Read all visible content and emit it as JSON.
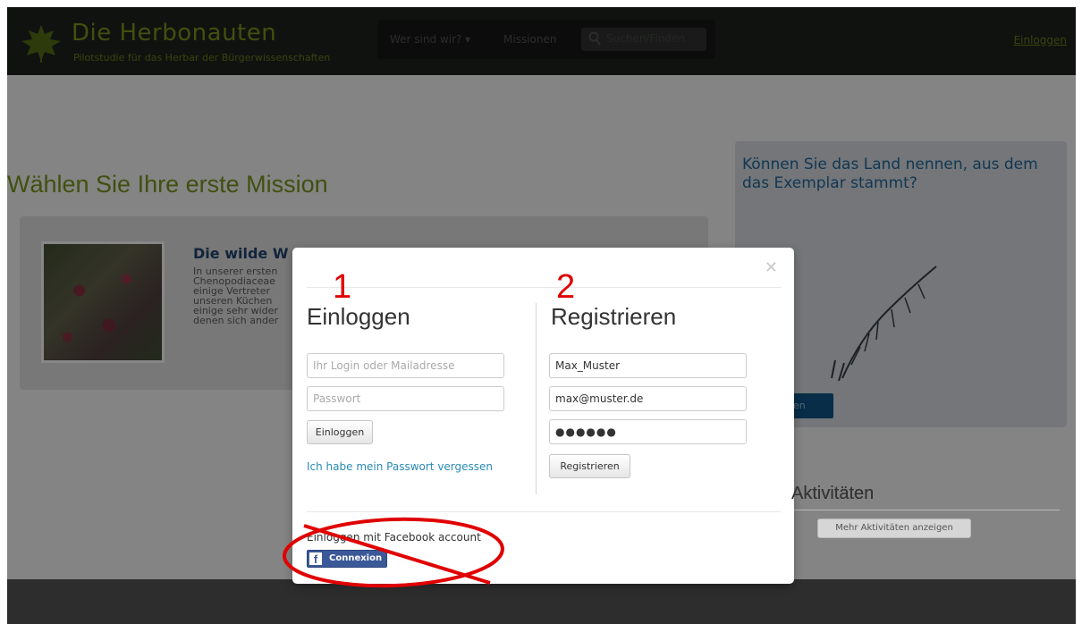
{
  "navbar": {
    "brand_title": "Die Herbonauten",
    "brand_subtitle": "Pilotstudie für das Herbar der Bürgerwissenschaften",
    "nav_who": "Wer sind wir? ▾",
    "nav_missions": "Missionen",
    "search_placeholder": "Suchen/Finden",
    "login_link": "Einloggen"
  },
  "page": {
    "title": "Wählen Sie Ihre erste Mission",
    "mission": {
      "heading": "Die wilde W",
      "description": "In unserer ersten Chenopodiaceae einige Vertreter unseren Küchen einige sehr wider denen sich ander"
    },
    "sidebar": {
      "question": "Können Sie das Land nennen, aus dem das Exemplar stammt?",
      "button_fragment": "gen"
    },
    "activities": {
      "title": "Aktivitäten",
      "more_button": "Mehr Aktivitäten anzeigen"
    }
  },
  "modal": {
    "annotation_1": "1",
    "annotation_2": "2",
    "login": {
      "title": "Einloggen",
      "login_placeholder": "Ihr Login oder Mailadresse",
      "password_placeholder": "Passwort",
      "submit": "Einloggen",
      "forgot": "Ich habe mein Passwort vergessen"
    },
    "register": {
      "title": "Registrieren",
      "username": "Max_Muster",
      "email": "max@muster.de",
      "password_mask": "●●●●●●",
      "submit": "Registrieren"
    },
    "facebook": {
      "label": "Einloggen mit Facebook account",
      "button": "Connexion"
    }
  },
  "colors": {
    "brand_green": "#6f8a1a",
    "annotation_red": "#e00000",
    "facebook_blue": "#3b5998",
    "link_blue": "#2a8ab8"
  }
}
